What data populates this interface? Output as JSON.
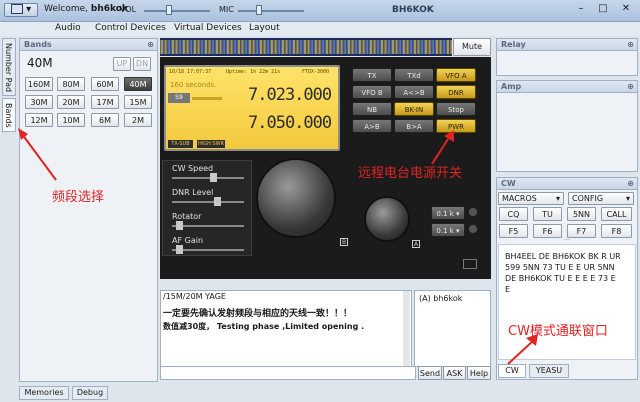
{
  "title": {
    "welcome": "Welcome, ",
    "user": "bh6kok",
    "vol": "VOL",
    "mic": "MIC",
    "app": "BH6KOK"
  },
  "menu": [
    "Audio",
    "Control Devices",
    "Virtual Devices",
    "Layout"
  ],
  "side_tabs": [
    "Number Pad",
    "Bands"
  ],
  "bands": {
    "header": "Bands",
    "current": "40M",
    "up": "UP",
    "dn": "DN",
    "buttons": [
      "160M",
      "80M",
      "60M",
      "40M",
      "30M",
      "20M",
      "17M",
      "15M",
      "12M",
      "10M",
      "6M",
      "2M"
    ],
    "selected": "40M"
  },
  "waterfall": {
    "mute": "Mute"
  },
  "rig": {
    "lcd_top_left": "10/18 17:07:37",
    "lcd_top_mid": "Uptime: 1h 22m 21s",
    "lcd_model": "FTDX-3000",
    "lcd_seconds": "160 seconds.",
    "lcd_s": "S9",
    "vfo_a": "7.023.000",
    "vfo_b": "7.050.000",
    "lcd_tags": [
      "TX-SUB",
      "HIGH SWR"
    ],
    "buttons": [
      "TX",
      "TXd",
      "VFO A",
      "VFO B",
      "A<>B",
      "DNR",
      "NB",
      "BK-IN",
      "Stop",
      "A>B",
      "B>A",
      "PWR"
    ],
    "highlighted": [
      "VFO A",
      "DNR",
      "BK-IN",
      "PWR"
    ],
    "sliders": [
      "CW Speed",
      "DNR Level",
      "Rotator",
      "AF Gain"
    ],
    "step1": "0.1 k",
    "step2": "0.1 k"
  },
  "chat": {
    "line1": "/15M/20M YAGE",
    "line2": "一定要先确认发射频段与相应的天线一致！！！",
    "line3": "数值减30度，  Testing phase ,Limited opening .",
    "user_list": [
      "(A) bh6kok"
    ],
    "send": "Send",
    "ask": "ASK",
    "help": "Help"
  },
  "relay": {
    "header": "Relay"
  },
  "amp": {
    "header": "Amp"
  },
  "cw": {
    "header": "CW",
    "macros": "MACROS",
    "config": "CONFIG",
    "buttons": [
      "CQ",
      "TU",
      "5NN",
      "CALL",
      "F5",
      "F6",
      "F7",
      "F8"
    ],
    "text": "BH4EEL DE BH6KOK BK R UR 599 5NN 73 TU E E UR 5NN DE BH6KOK TU E E E E 73 E E",
    "tabs": [
      "CW",
      "YEASU"
    ]
  },
  "bottom_tabs": [
    "Memories",
    "Debug"
  ],
  "annotations": {
    "band": "频段选择",
    "power": "远程电台电源开关",
    "cw": "CW模式通联窗口"
  },
  "colors": {
    "accent_red": "#e02424",
    "lcd": "#f6cf45",
    "highlight": "#e0b52c"
  }
}
